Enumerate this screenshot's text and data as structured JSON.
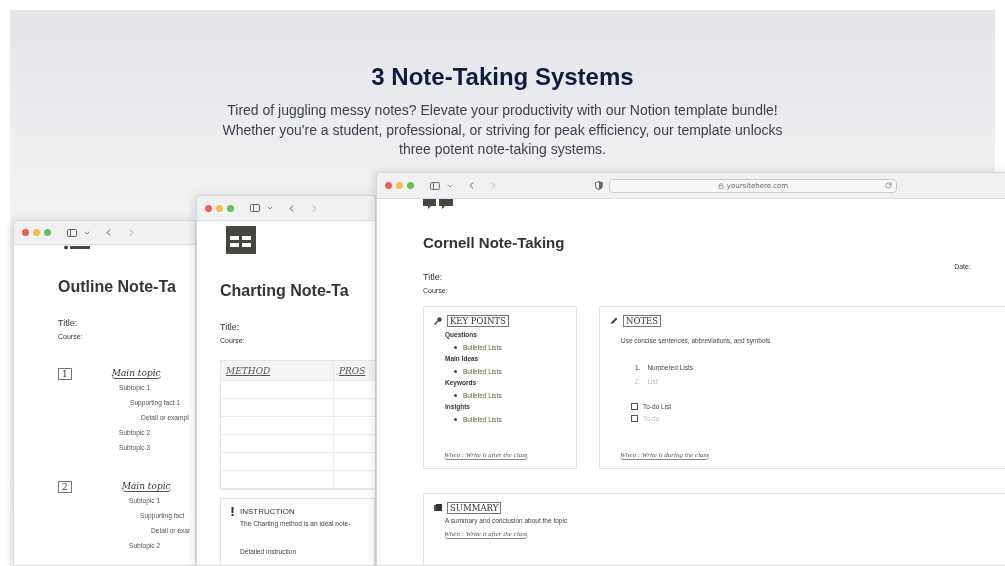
{
  "hero": {
    "title": "3 Note-Taking Systems",
    "subtitle": "Tired of juggling messy notes? Elevate your productivity with our Notion template bundle! Whether you're a student, professional, or striving for peak efficiency, our template unlocks three potent note-taking systems."
  },
  "windows": [
    {
      "kind": "outline",
      "heading": "Outline Note-Ta",
      "fields": [
        "Title:",
        "Course:"
      ],
      "sections": [
        {
          "number": "1",
          "topic": "Main topic",
          "children": [
            {
              "text": "Subtopic 1",
              "children": [
                {
                  "text": "Supporting fact 1",
                  "children": [
                    {
                      "text": "Detail or exampl"
                    }
                  ]
                }
              ]
            },
            {
              "text": "Subtopic 2"
            },
            {
              "text": "Subtopic 3"
            }
          ]
        },
        {
          "number": "2",
          "topic": "Main topic",
          "children": [
            {
              "text": "Subtopic 1",
              "children": [
                {
                  "text": "Supporting fact",
                  "children": [
                    {
                      "text": "Detail or exar"
                    }
                  ]
                }
              ]
            },
            {
              "text": "Subtopic 2"
            }
          ]
        }
      ]
    },
    {
      "kind": "charting",
      "heading": "Charting Note-Ta",
      "fields": [
        "Title:",
        "Course:"
      ],
      "columns": [
        "METHOD",
        "PROS"
      ],
      "callout": {
        "title": "INSTRUCTION",
        "text": "The Charting method is an ideal note-",
        "detail": "Detailed instruction"
      }
    },
    {
      "kind": "cornell",
      "url": "yoursitehere.com",
      "heading": "Cornell Note-Taking",
      "title_field": "Title:",
      "date_field": "Date:",
      "course_field": "Course:",
      "key_points": {
        "label": "KEY POINTS",
        "groups": [
          {
            "name": "Questions",
            "items": [
              "Bulleted Lists"
            ]
          },
          {
            "name": "Main Ideas",
            "items": [
              "Bulleted Lists"
            ]
          },
          {
            "name": "Keywords",
            "items": [
              "Bulleted Lists"
            ]
          },
          {
            "name": "Insights",
            "items": [
              "Bulleted Lists"
            ]
          }
        ],
        "footer": "When : Write it after the class"
      },
      "notes": {
        "label": "NOTES",
        "intro": "Use concise sentences, abbreviations, and symbols",
        "numbered": [
          {
            "number": "1.",
            "text": "Numbered Lists",
            "muted": false
          },
          {
            "number": "2.",
            "text": "List",
            "muted": true
          }
        ],
        "todos": [
          {
            "text": "To-do List",
            "checked": false,
            "muted": false
          },
          {
            "text": "To-do",
            "checked": false,
            "muted": true
          }
        ],
        "footer": "When : Write it during the class"
      },
      "summary": {
        "label": "SUMMARY",
        "text": "A summary and conclusion about the topic",
        "footer": "When : Write it after the class"
      }
    }
  ]
}
